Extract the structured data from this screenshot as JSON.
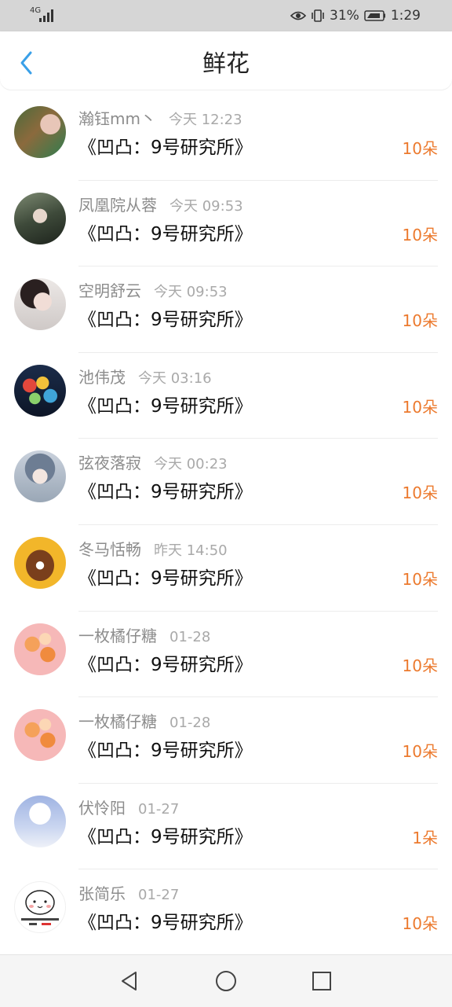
{
  "status_bar": {
    "network": "4G",
    "signal_strength": "4/4",
    "battery_percent": "31%",
    "time": "1:29"
  },
  "header": {
    "title": "鲜花",
    "back_icon": "chevron-left-icon",
    "accent_color": "#3aa0e8"
  },
  "gifts": [
    {
      "avatar_style": "photo-green",
      "name": "瀚钰mm丶",
      "time": "今天 12:23",
      "book": "《凹凸：9号研究所》",
      "count": "10朵"
    },
    {
      "avatar_style": "photo-dark",
      "name": "凤凰院从蓉",
      "time": "今天 09:53",
      "book": "《凹凸：9号研究所》",
      "count": "10朵"
    },
    {
      "avatar_style": "photo-pale",
      "name": "空明舒云",
      "time": "今天 09:53",
      "book": "《凹凸：9号研究所》",
      "count": "10朵"
    },
    {
      "avatar_style": "balloons",
      "name": "池伟茂",
      "time": "今天 03:16",
      "book": "《凹凸：9号研究所》",
      "count": "10朵"
    },
    {
      "avatar_style": "illustration",
      "name": "弦夜落寂",
      "time": "今天 00:23",
      "book": "《凹凸：9号研究所》",
      "count": "10朵"
    },
    {
      "avatar_style": "horse-cartoon",
      "name": "冬马恬畅",
      "time": "昨天 14:50",
      "book": "《凹凸：9号研究所》",
      "count": "10朵"
    },
    {
      "avatar_style": "floral-pink",
      "name": "一枚橘仔糖",
      "time": "01-28",
      "book": "《凹凸：9号研究所》",
      "count": "10朵"
    },
    {
      "avatar_style": "floral-pink",
      "name": "一枚橘仔糖",
      "time": "01-28",
      "book": "《凹凸：9号研究所》",
      "count": "10朵"
    },
    {
      "avatar_style": "snow-tree",
      "name": "伏怜阳",
      "time": "01-27",
      "book": "《凹凸：9号研究所》",
      "count": "1朵"
    },
    {
      "avatar_style": "sticker",
      "name": "张简乐",
      "time": "01-27",
      "book": "《凹凸：9号研究所》",
      "count": "10朵"
    }
  ],
  "colors": {
    "count": "#ec7a2e",
    "name": "#8c8c8c",
    "time": "#a9a9a9"
  },
  "nav_bar": {
    "back": "triangle-back-icon",
    "home": "circle-home-icon",
    "recents": "square-recents-icon"
  }
}
